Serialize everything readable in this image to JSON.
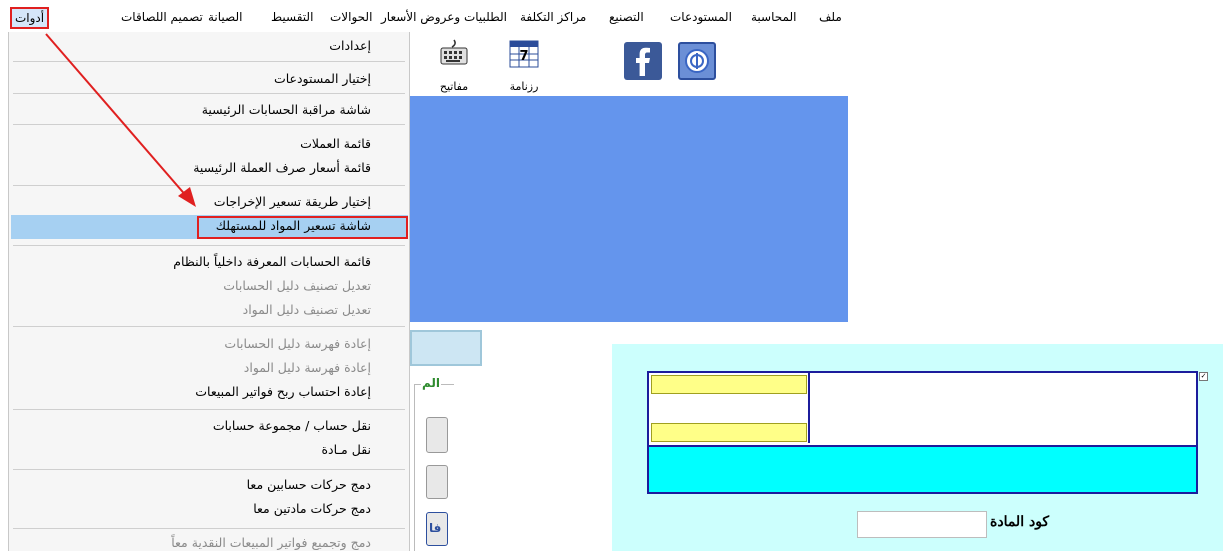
{
  "menubar": {
    "items": [
      "ملف",
      "المحاسبة",
      "المستودعات",
      "التصنيع",
      "مراكز التكلفة",
      "الطلبيات وعروض الأسعار",
      "الحوالات",
      "التقسيط",
      "الصيانة",
      "تصميم اللصاقات",
      "أدوات"
    ]
  },
  "toolbar": {
    "keyboard_label": "مفاتيح",
    "calendar_label": "رزنامة",
    "calendar_day": "7"
  },
  "dropdown": {
    "items": [
      {
        "label": "إعدادات",
        "enabled": true
      },
      {
        "label": "إختيار المستودعات",
        "enabled": true
      },
      {
        "label": "شاشة مراقبة الحسابات الرئيسية",
        "enabled": true
      },
      {
        "label": "قائمة العملات",
        "enabled": true
      },
      {
        "label": "قائمة أسعار صرف العملة الرئيسية",
        "enabled": true
      },
      {
        "label": "إختيار طريقة تسعير الإخراجات",
        "enabled": true
      },
      {
        "label": "شاشة تسعير المواد للمستهلك",
        "enabled": true
      },
      {
        "label": "قائمة الحسابات المعرفة داخلياً بالنظام",
        "enabled": true
      },
      {
        "label": "تعديل تصنيف دليل الحسابات",
        "enabled": false
      },
      {
        "label": "تعديل تصنيف دليل المواد",
        "enabled": false
      },
      {
        "label": "إعادة فهرسة دليل الحسابات",
        "enabled": false
      },
      {
        "label": "إعادة فهرسة دليل المواد",
        "enabled": false
      },
      {
        "label": "إعادة احتساب ربح فواتير المبيعات",
        "enabled": true
      },
      {
        "label": "نقل حساب / مجموعة حسابات",
        "enabled": true
      },
      {
        "label": "نقل مـادة",
        "enabled": true
      },
      {
        "label": "دمج حركات حسابين معا",
        "enabled": true
      },
      {
        "label": "دمج حركات مادتين معا",
        "enabled": true
      },
      {
        "label": "دمج وتجميع فواتير المبيعات النقدية معاً",
        "enabled": false
      }
    ]
  },
  "lower_dialog": {
    "group_label": "الم",
    "button_label": "فا"
  },
  "right_dialog": {
    "item_code_label": "كود المادة",
    "item_code_value": "",
    "checkbox_mark": "✓"
  },
  "colors": {
    "workspace": "#6495ed",
    "highlight": "#a6d0f2",
    "annotation": "#e02020",
    "dialog_bg": "#ccfffd",
    "cyan_row": "#00ffff",
    "frame": "#1c1c9c",
    "yellow_cell": "#ffff88"
  }
}
